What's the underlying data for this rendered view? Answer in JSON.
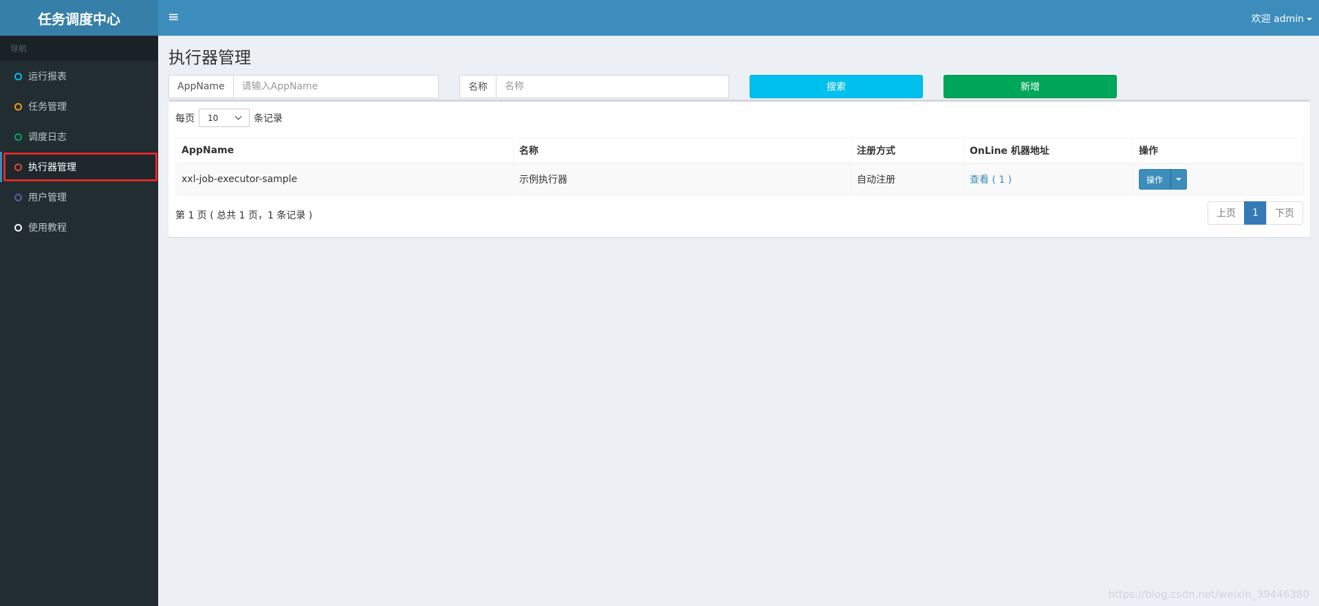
{
  "sidebar": {
    "logo": "任务调度中心",
    "header": "导航",
    "items": [
      {
        "label": "运行报表",
        "color": "#00c0ef"
      },
      {
        "label": "任务管理",
        "color": "#f39c12"
      },
      {
        "label": "调度日志",
        "color": "#00a65a"
      },
      {
        "label": "执行器管理",
        "color": "#dd4b39",
        "active": true
      },
      {
        "label": "用户管理",
        "color": "#605ca8"
      },
      {
        "label": "使用教程",
        "color": "#ffffff"
      }
    ]
  },
  "header": {
    "menu_icon": "≡",
    "welcome": "欢迎 admin"
  },
  "page": {
    "title": "执行器管理"
  },
  "filters": {
    "appname_label": "AppName",
    "appname_placeholder": "请输入AppName",
    "name_label": "名称",
    "name_placeholder": "名称",
    "search_button": "搜索",
    "add_button": "新增"
  },
  "table": {
    "length_prefix": "每页",
    "length_value": "10",
    "length_suffix": "条记录",
    "columns": [
      "AppName",
      "名称",
      "注册方式",
      "OnLine 机器地址",
      "操作"
    ],
    "rows": [
      {
        "appname": "xxl-job-executor-sample",
        "name": "示例执行器",
        "reg": "自动注册",
        "online": "查看 ( 1 )",
        "op": "操作"
      }
    ],
    "info": "第 1 页 ( 总共 1 页，1 条记录 )",
    "pager": {
      "prev": "上页",
      "current": "1",
      "next": "下页"
    }
  },
  "watermark": "https://blog.csdn.net/weixin_39446380"
}
